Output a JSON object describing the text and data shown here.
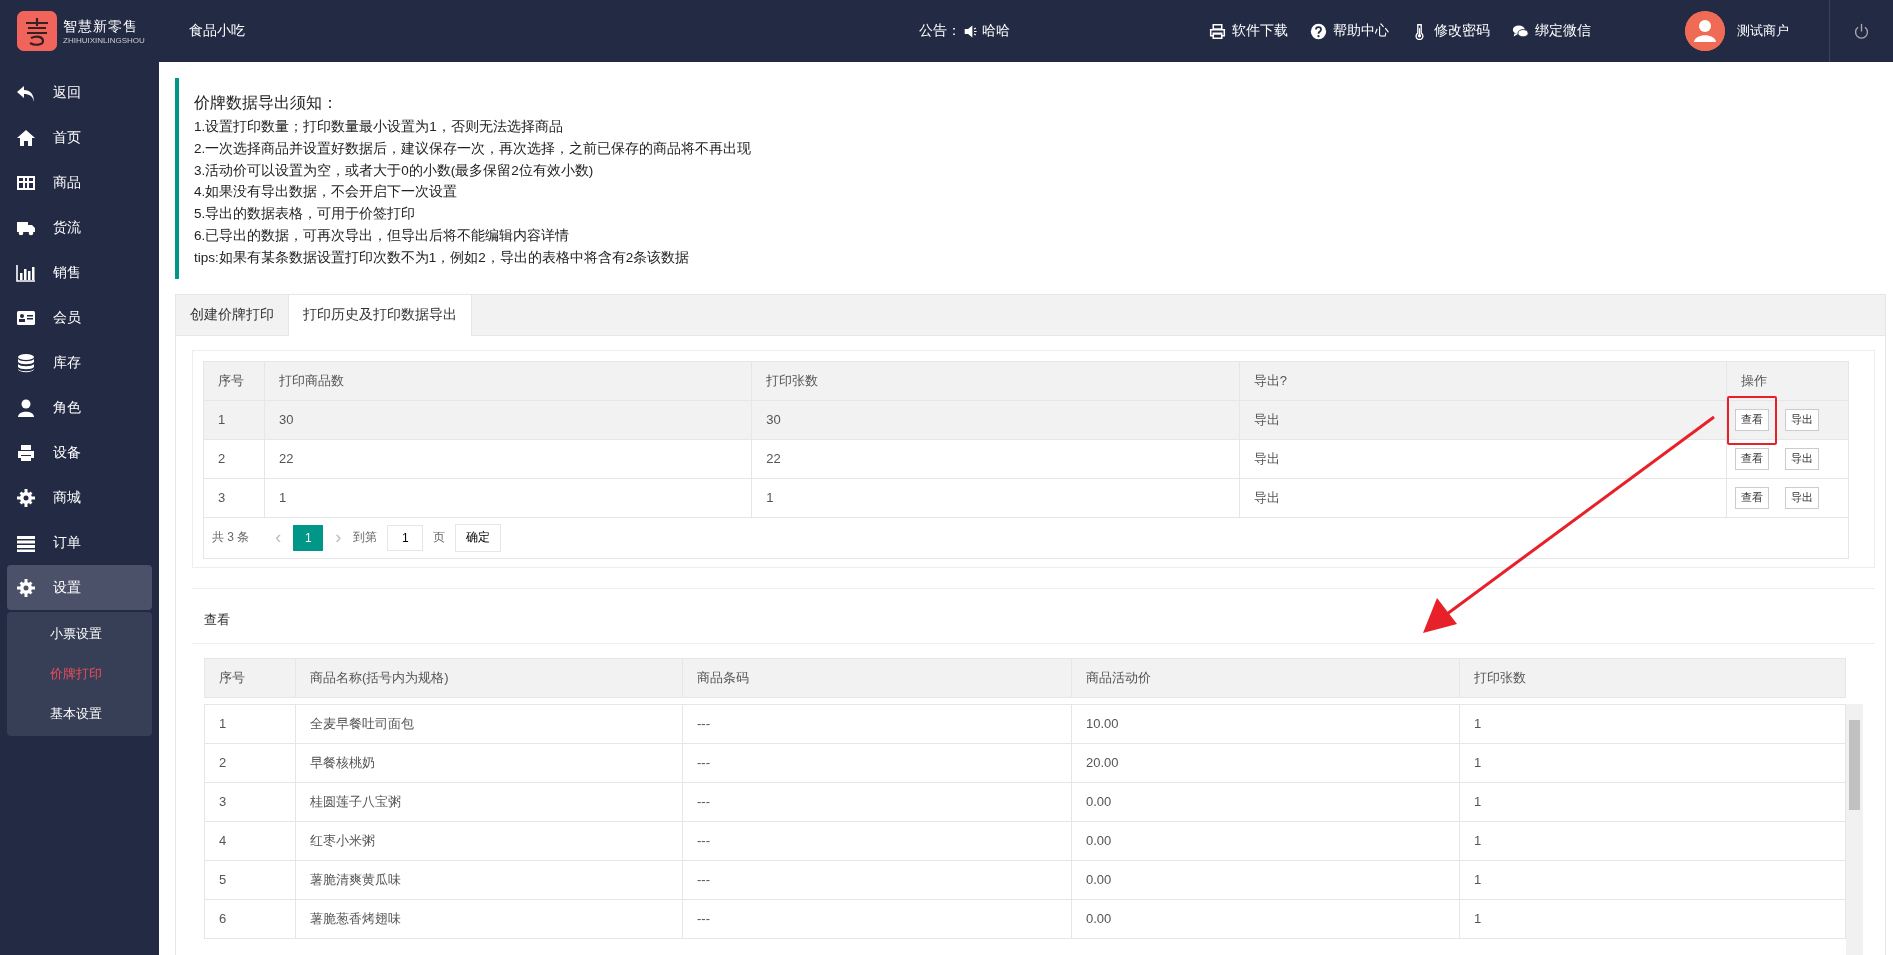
{
  "header": {
    "brand": "智慧新零售",
    "brand_sub": "ZHIHUIXINLINGSHOU",
    "store": "食品小吃",
    "notice_label": "公告：",
    "notice_text": "哈哈",
    "links": [
      {
        "label": "软件下载"
      },
      {
        "label": "帮助中心"
      },
      {
        "label": "修改密码"
      },
      {
        "label": "绑定微信"
      }
    ],
    "user": "测试商户"
  },
  "sidebar": {
    "items": [
      {
        "label": "返回",
        "selected": false
      },
      {
        "label": "首页",
        "selected": false
      },
      {
        "label": "商品",
        "selected": false
      },
      {
        "label": "货流",
        "selected": false
      },
      {
        "label": "销售",
        "selected": false
      },
      {
        "label": "会员",
        "selected": false
      },
      {
        "label": "库存",
        "selected": false
      },
      {
        "label": "角色",
        "selected": false
      },
      {
        "label": "设备",
        "selected": false
      },
      {
        "label": "商城",
        "selected": false
      },
      {
        "label": "订单",
        "selected": false
      },
      {
        "label": "设置",
        "selected": true,
        "expanded": true,
        "children": [
          {
            "label": "小票设置",
            "selected": false
          },
          {
            "label": "价牌打印",
            "selected": true
          },
          {
            "label": "基本设置",
            "selected": false
          }
        ]
      }
    ]
  },
  "notice": {
    "title": "价牌数据导出须知：",
    "lines": [
      "1.设置打印数量；打印数量最小设置为1，否则无法选择商品",
      "2.一次选择商品并设置好数据后，建议保存一次，再次选择，之前已保存的商品将不再出现",
      "3.活动价可以设置为空，或者大于0的小数(最多保留2位有效小数)",
      "4.如果没有导出数据，不会开启下一次设置",
      "5.导出的数据表格，可用于价签打印",
      "6.已导出的数据，可再次导出，但导出后将不能编辑内容详情",
      "tips:如果有某条数据设置打印次数不为1，例如2，导出的表格中将含有2条该数据"
    ]
  },
  "tabs": [
    {
      "label": "创建价牌打印",
      "selected": false
    },
    {
      "label": "打印历史及打印数据导出",
      "selected": true
    }
  ],
  "history_table": {
    "columns": [
      "序号",
      "打印商品数",
      "打印张数",
      "导出?",
      "操作"
    ],
    "rows": [
      {
        "cells": [
          "1",
          "30",
          "30",
          "导出"
        ],
        "actions": [
          "查看",
          "导出"
        ],
        "selected": true,
        "highlighted": true
      },
      {
        "cells": [
          "2",
          "22",
          "22",
          "导出"
        ],
        "actions": [
          "查看",
          "导出"
        ],
        "selected": false,
        "highlighted": false
      },
      {
        "cells": [
          "3",
          "1",
          "1",
          "导出"
        ],
        "actions": [
          "查看",
          "导出"
        ],
        "selected": false,
        "highlighted": false
      }
    ]
  },
  "pagination": {
    "total": "共 3 条",
    "prev": "‹",
    "pages": [
      {
        "label": "1",
        "selected": true
      }
    ],
    "next": "›",
    "goto_label": "到第",
    "goto_value": "1",
    "page_unit": "页",
    "confirm": "确定"
  },
  "detail": {
    "title": "查看",
    "columns": [
      "序号",
      "商品名称(括号内为规格)",
      "商品条码",
      "商品活动价",
      "打印张数"
    ],
    "rows": [
      [
        "1",
        "全麦早餐吐司面包",
        "---",
        "10.00",
        "1"
      ],
      [
        "2",
        "早餐核桃奶",
        "---",
        "20.00",
        "1"
      ],
      [
        "3",
        "桂圆莲子八宝粥",
        "---",
        "0.00",
        "1"
      ],
      [
        "4",
        "红枣小米粥",
        "---",
        "0.00",
        "1"
      ],
      [
        "5",
        "薯脆清爽黄瓜味",
        "---",
        "0.00",
        "1"
      ],
      [
        "6",
        "薯脆葱香烤翅味",
        "---",
        "0.00",
        "1"
      ]
    ]
  }
}
